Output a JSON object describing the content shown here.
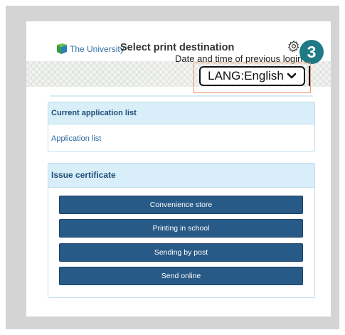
{
  "header": {
    "logo_text": "The University",
    "title": "Select print destination",
    "last_login": "Date and time of previous login",
    "badge": "3",
    "language_select": "LANG:English"
  },
  "application_panel": {
    "title": "Current application list",
    "link": "Application list"
  },
  "issue_panel": {
    "title": "Issue certificate",
    "buttons": [
      "Convenience store",
      "Printing in school",
      "Sending by post",
      "Send online"
    ]
  },
  "colors": {
    "button": "#285a87",
    "panel_header": "#d8eef9",
    "badge": "#1f7a85",
    "highlight": "#e8956a"
  },
  "icons": [
    "university-logo-icon",
    "gear-icon",
    "chevron-down-icon"
  ]
}
